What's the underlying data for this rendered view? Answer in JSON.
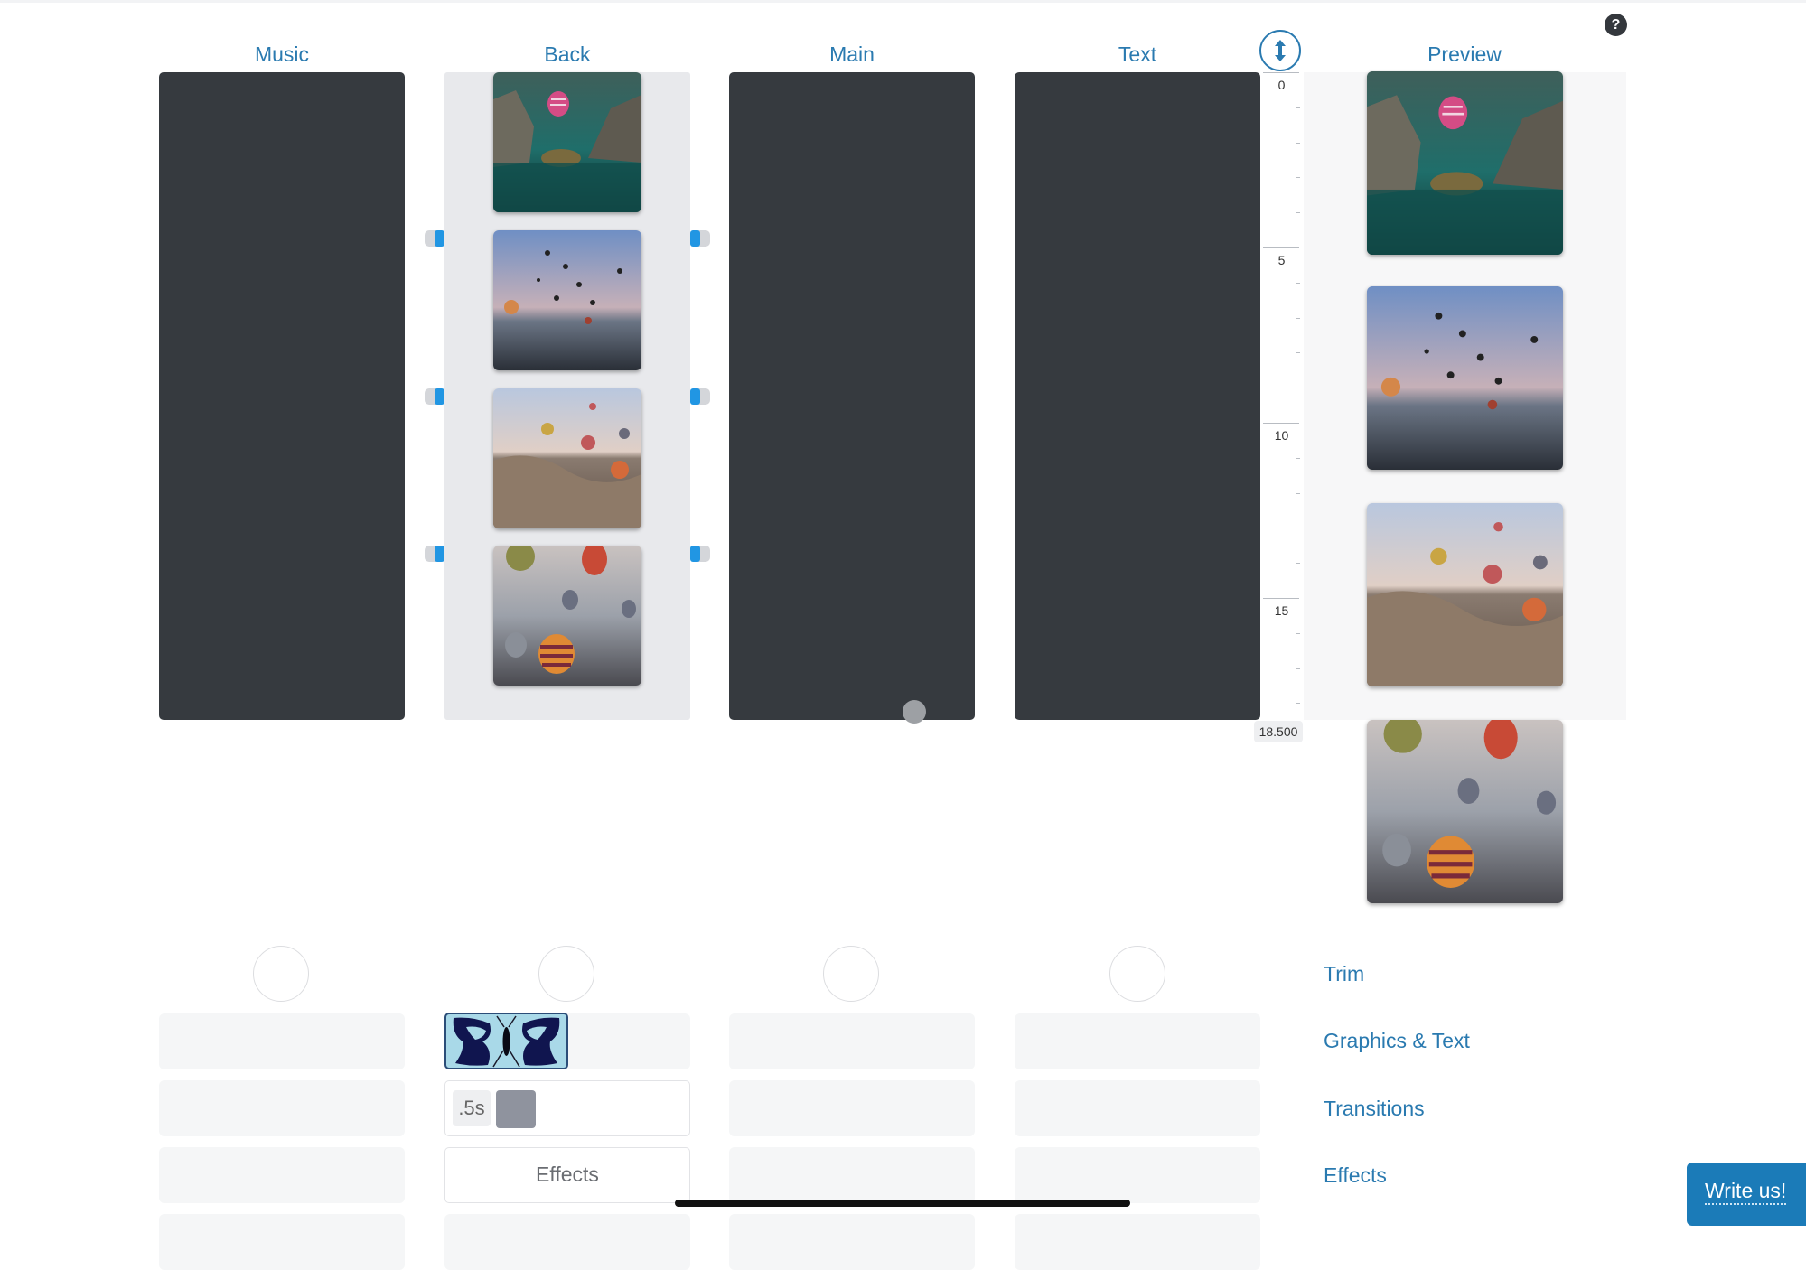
{
  "columns": [
    {
      "key": "music",
      "label": "Music"
    },
    {
      "key": "back",
      "label": "Back"
    },
    {
      "key": "main",
      "label": "Main"
    },
    {
      "key": "text",
      "label": "Text"
    }
  ],
  "preview": {
    "label": "Preview"
  },
  "help": {
    "label": "?"
  },
  "ruler": {
    "toggle_icon": "vertical-resize-icon",
    "ticks": [
      "0",
      "5",
      "10",
      "15"
    ],
    "end_label": "18.500"
  },
  "back_clips": [
    {
      "name": "turtle-balloon",
      "description": "Turtle in water with pink striped balloon"
    },
    {
      "name": "balloons-dusk",
      "description": "Many balloons over valley at dusk"
    },
    {
      "name": "balloons-rocks",
      "description": "Balloons over rocky landscape"
    },
    {
      "name": "balloons-closeup",
      "description": "Colorful balloons close-up"
    }
  ],
  "back_controls": {
    "duration": ".5s",
    "effects_label": "Effects",
    "swatch_color": "#8f939e"
  },
  "side_menu": [
    "Trim",
    "Graphics & Text",
    "Transitions",
    "Effects"
  ],
  "write_us": {
    "label": "Write us!"
  },
  "colors": {
    "accent": "#2a7ab0",
    "panel_dark": "#363a3f",
    "handle": "#2196e3",
    "button": "#1b7bb8"
  }
}
